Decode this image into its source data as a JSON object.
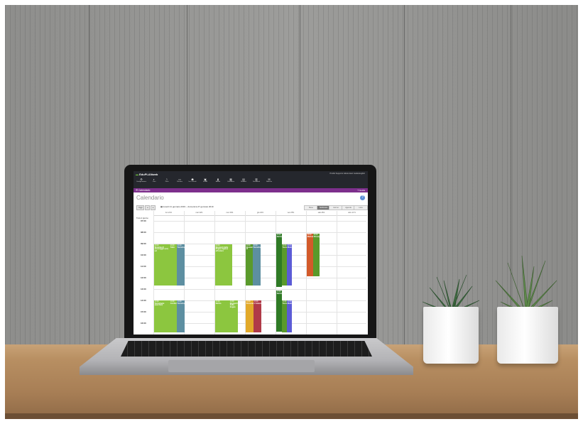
{
  "app": {
    "brand_prefix": "Edu",
    "brand_main": "PLAN",
    "brand_suffix": "web",
    "topbar_right": "Profilo  Supporto  Istituto  Esci  Guida  English",
    "nav": [
      {
        "label": "Configurazione",
        "icon": "⚙"
      },
      {
        "label": "Orari",
        "icon": "◐"
      },
      {
        "label": "Piani",
        "icon": "⌇"
      },
      {
        "label": "Persone",
        "icon": "▭"
      },
      {
        "label": "Ins. annuali",
        "icon": "☗"
      },
      {
        "label": "Ins/Alt",
        "icon": "▣"
      },
      {
        "label": "Attività",
        "icon": "▮"
      },
      {
        "label": "Calendario",
        "icon": "▦"
      },
      {
        "label": "Studenti",
        "icon": "▤"
      },
      {
        "label": "Documenti",
        "icon": "▥"
      },
      {
        "label": "Notifiche",
        "icon": "✉"
      }
    ],
    "section_title": "Calendario",
    "help_label": "Guida",
    "page_title": "Calendario",
    "toolbar": {
      "today": "Oggi",
      "prev": "◂",
      "next": "▸",
      "date_range": "lunedì 21 gennaio 2019 – domenica 27 gennaio 2019",
      "views": [
        "Mese",
        "Settimana",
        "Giorno",
        "Agenda",
        "Lista"
      ],
      "active_view": "Settimana"
    },
    "days": [
      "lun 21/1",
      "mar 22/1",
      "mer 23/1",
      "gio 24/1",
      "ven 25/1",
      "sab 26/1",
      "dom 27/1"
    ],
    "allday_label": "Tutto il giorno",
    "hours": [
      "07:00",
      "08:00",
      "09:00",
      "10:00",
      "11:00",
      "12:00",
      "13:00",
      "14:00",
      "15:00",
      "16:00"
    ],
    "events": [
      {
        "title": "Sistema di stoccaggio (co) ed",
        "time": "09:00",
        "color": "#8cc63f"
      },
      {
        "title": "Tatto",
        "time": "09:00",
        "color": "#8cc63f"
      },
      {
        "title": "Tecnologie",
        "time": "09:00",
        "color": "#5d8fa1"
      },
      {
        "title": "Elementi delle lingue inglese all'estero",
        "time": "09:00",
        "color": "#8cc63f"
      },
      {
        "title": "Elementi di",
        "time": "09:00",
        "color": "#5a9a2b"
      },
      {
        "title": "Tecnologie",
        "time": "09:00",
        "color": "#5d8fa1"
      },
      {
        "title": "Diritto",
        "time": "08:00",
        "color": "#2f7a25"
      },
      {
        "title": "Tecnol",
        "time": "09:00",
        "color": "#5a9a2b"
      },
      {
        "title": "Modul",
        "time": "09:00",
        "color": "#5b5bd6"
      },
      {
        "title": "Marketi",
        "time": "08:00",
        "color": "#d35a2a"
      },
      {
        "title": "Princip",
        "time": "08:00",
        "color": "#5a9a2b"
      },
      {
        "title": "Tecnologie (cerchio)",
        "time": "14:00",
        "color": "#8cc63f"
      },
      {
        "title": "Conferma",
        "time": "14:00",
        "color": "#8cc63f"
      },
      {
        "title": "Tecnologie",
        "time": "14:00",
        "color": "#5d8fa1"
      },
      {
        "title": "Diritto",
        "time": "14:00",
        "color": "#8cc63f"
      },
      {
        "title": "Elementi della lingua",
        "time": "14:00",
        "color": "#8cc63f"
      },
      {
        "title": "Persone",
        "time": "14:00",
        "color": "#e2a92a"
      },
      {
        "title": "L'Azienda",
        "time": "14:00",
        "color": "#b03a48"
      },
      {
        "title": "Diritto",
        "time": "13:00",
        "color": "#2f7a25"
      },
      {
        "title": "Tecnol",
        "time": "14:00",
        "color": "#5a9a2b"
      },
      {
        "title": "Modul",
        "time": "14:00",
        "color": "#5b5bd6"
      }
    ]
  }
}
